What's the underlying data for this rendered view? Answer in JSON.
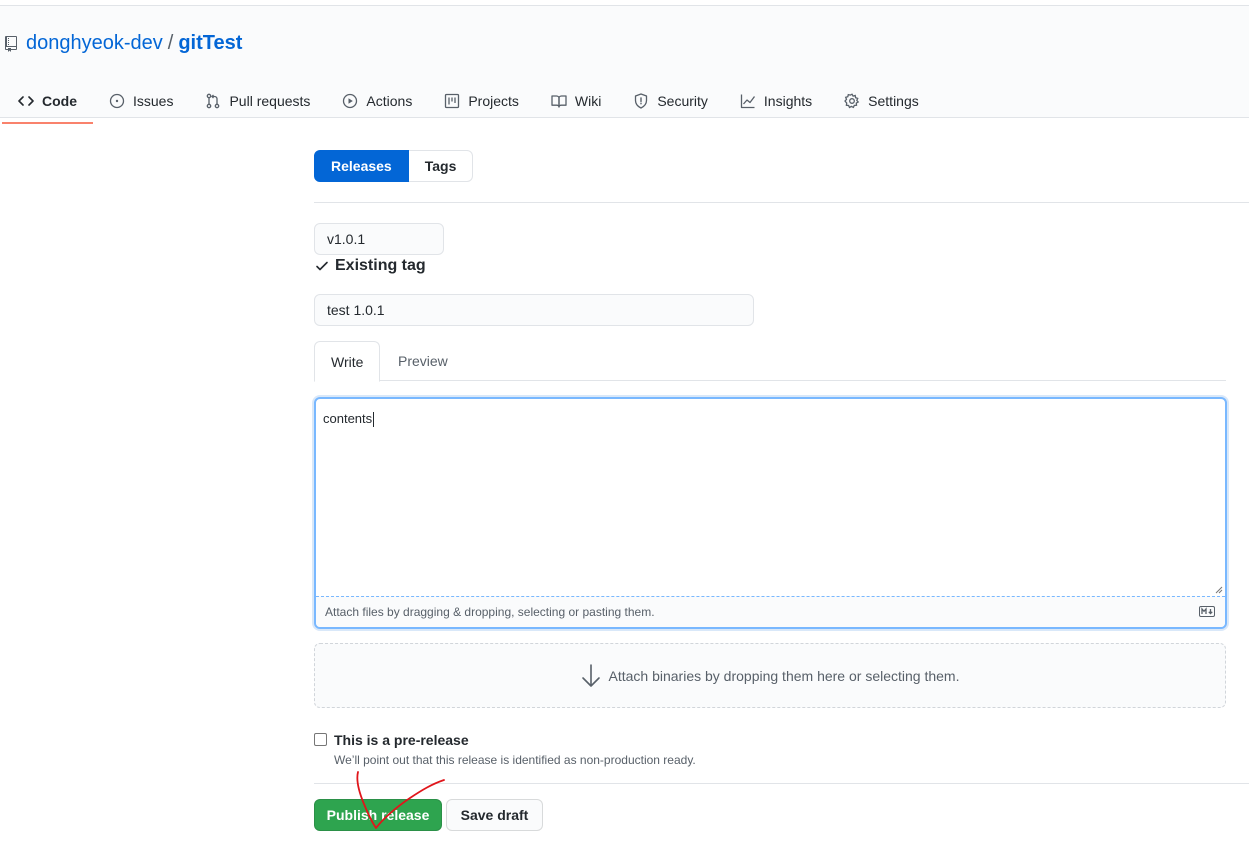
{
  "repo": {
    "owner": "donghyeok-dev",
    "separator": "/",
    "name": "gitTest"
  },
  "nav_tabs": [
    {
      "label": "Code",
      "icon": "code-icon",
      "active": true
    },
    {
      "label": "Issues",
      "icon": "issue-icon"
    },
    {
      "label": "Pull requests",
      "icon": "pull-request-icon"
    },
    {
      "label": "Actions",
      "icon": "play-icon"
    },
    {
      "label": "Projects",
      "icon": "project-icon"
    },
    {
      "label": "Wiki",
      "icon": "book-icon"
    },
    {
      "label": "Security",
      "icon": "shield-icon"
    },
    {
      "label": "Insights",
      "icon": "graph-icon"
    },
    {
      "label": "Settings",
      "icon": "gear-icon"
    }
  ],
  "subnav": {
    "releases": "Releases",
    "tags": "Tags"
  },
  "release_form": {
    "tag_value": "v1.0.1",
    "tag_status": "Existing tag",
    "title_value": "test 1.0.1",
    "write_tab": "Write",
    "preview_tab": "Preview",
    "body_text": "contents",
    "attach_hint": "Attach files by dragging & dropping, selecting or pasting them.",
    "binaries_hint": "Attach binaries by dropping them here or selecting them.",
    "prerelease_label": "This is a pre-release",
    "prerelease_note": "We’ll point out that this release is identified as non-production ready.",
    "publish_button": "Publish release",
    "save_draft_button": "Save draft"
  },
  "colors": {
    "link": "#0366d6",
    "primary_button": "#2ea44f",
    "active_tab_underline": "#f9826c",
    "annotation_stroke": "#e0161b"
  }
}
